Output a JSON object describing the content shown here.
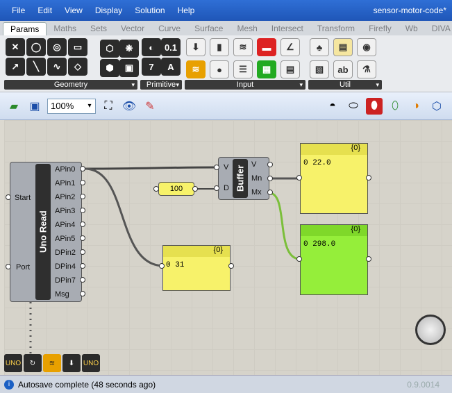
{
  "menubar": {
    "items": [
      "File",
      "Edit",
      "View",
      "Display",
      "Solution",
      "Help"
    ],
    "title": "sensor-motor-code*"
  },
  "tabs": [
    "Params",
    "Maths",
    "Sets",
    "Vector",
    "Curve",
    "Surface",
    "Mesh",
    "Intersect",
    "Transform",
    "Firefly",
    "Wb",
    "DIVA"
  ],
  "ribbon": {
    "panels": [
      "Geometry",
      "Primitive",
      "Input",
      "Util"
    ],
    "primitive_glyphs": [
      "0.1",
      "7",
      "A"
    ]
  },
  "toolbar": {
    "zoom": "100%"
  },
  "canvas": {
    "uno": {
      "title": "Uno Read",
      "inputs": [
        "Start",
        "Port"
      ],
      "outputs": [
        "APin0",
        "APin1",
        "APin2",
        "APin3",
        "APin4",
        "APin5",
        "DPin2",
        "DPin4",
        "DPin7",
        "Msg"
      ]
    },
    "number_slider": "100",
    "buffer": {
      "title": "Buffer",
      "inputs": [
        "V",
        "D"
      ],
      "outputs": [
        "V",
        "Mn",
        "Mx"
      ]
    },
    "panels": [
      {
        "header": "{0}",
        "value": "0 22.0"
      },
      {
        "header": "{0}",
        "value": "0 298.0"
      },
      {
        "header": "{0}",
        "value": "0 31"
      }
    ]
  },
  "bottom_tools": [
    "UNO",
    "UNO"
  ],
  "status": {
    "message": "Autosave complete (48 seconds ago)",
    "version": "0.9.0014"
  }
}
